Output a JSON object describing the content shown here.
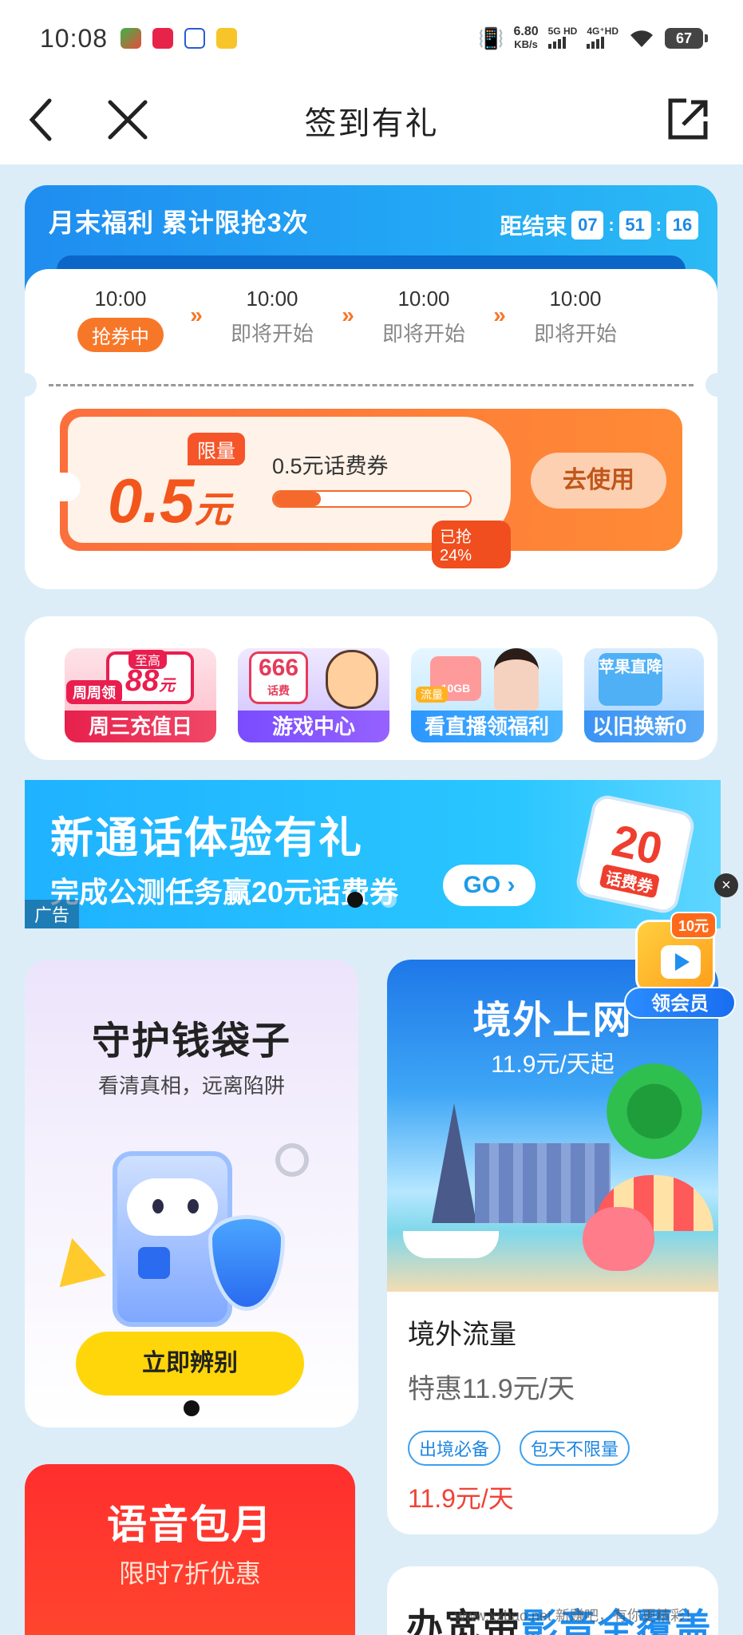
{
  "status_bar": {
    "time": "10:08",
    "speed_value": "6.80",
    "speed_unit": "KB/s",
    "net1": "5G HD",
    "net2": "4G⁺HD",
    "battery": "67"
  },
  "nav": {
    "title": "签到有礼"
  },
  "coupon_section": {
    "header": "月末福利  累计限抢3次",
    "countdown_label": "距结束",
    "countdown": [
      "07",
      "51",
      "16"
    ],
    "schedule": [
      {
        "time": "10:00",
        "status": "抢券中"
      },
      {
        "time": "10:00",
        "status": "即将开始"
      },
      {
        "time": "10:00",
        "status": "即将开始"
      },
      {
        "time": "10:00",
        "status": "即将开始"
      }
    ],
    "coupon": {
      "limit_tag": "限量",
      "amount": "0.5",
      "unit": "元",
      "name": "0.5元话费券",
      "progress_percent": 24,
      "grabbed_label": "已抢24%",
      "use_button": "去使用"
    }
  },
  "quick_entries": {
    "items": [
      {
        "label": "周三充值日",
        "badge_top": "至高",
        "badge_value": "88",
        "badge_unit": "元",
        "badge_tag": "周周领"
      },
      {
        "label": "游戏中心",
        "badge_value": "666",
        "badge_sub": "话费"
      },
      {
        "label": "看直播领福利",
        "badge_tag": "流量",
        "badge_sub": "10GB"
      },
      {
        "label": "以旧换新0",
        "badge_value": "苹果直降"
      }
    ]
  },
  "ad_banner": {
    "headline": "新通话体验有礼",
    "subline": "完成公测任务赢20元话费券",
    "go_button": "GO ›",
    "ad_tag": "广告",
    "ticket_value": "20",
    "ticket_unit": "元",
    "ticket_word": "话费券"
  },
  "float_member": {
    "tag": "10元",
    "label": "领会员"
  },
  "protect_card": {
    "title": "守护钱袋子",
    "subtitle": "看清真相，远离陷阱",
    "button": "立即辨别"
  },
  "overseas_card": {
    "image_title": "境外上网",
    "image_price": "11.9元/天起",
    "name": "境外流量",
    "discount": "特惠11.9元/天",
    "tags": [
      "出境必备",
      "包天不限量"
    ],
    "price": "11.9元/天"
  },
  "voice_card": {
    "title": "语音包月",
    "subtitle": "限时7折优惠"
  },
  "office_card": {
    "title_black": "办宽带",
    "title_blue": "影音全覆盖"
  },
  "watermark": "www.xxbao.net 新赚吧，有你更精彩！"
}
